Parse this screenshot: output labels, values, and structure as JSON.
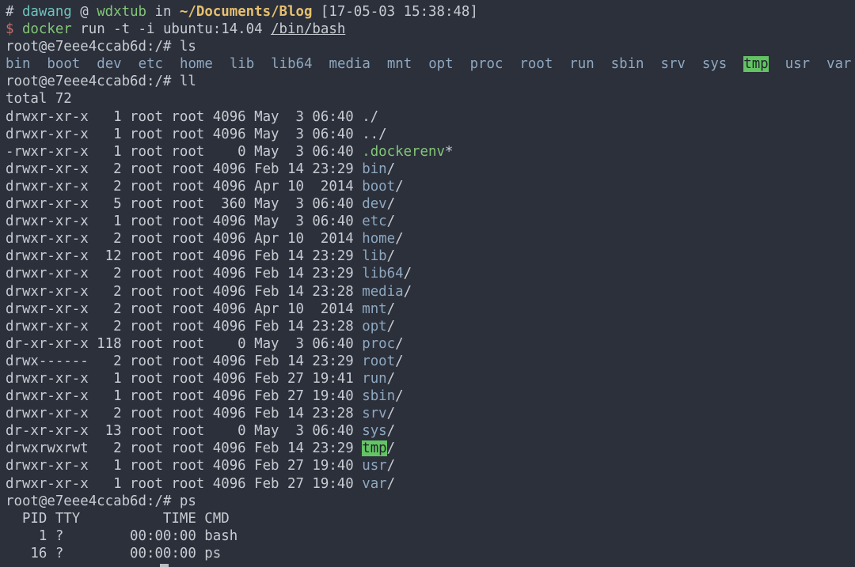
{
  "terminal": {
    "title": "shell session - docker run ubuntu:14.04",
    "colors": {
      "bg": "#2b303b",
      "fg": "#c7ccd2",
      "cyan": "#6ec3bd",
      "green": "#83c577",
      "yellow": "#e6c06e",
      "red": "#c96c68",
      "blue": "#8fa8c0",
      "selGreenBg": "#63c463",
      "selText": "#20242c",
      "cursor": "#b9bec4"
    },
    "lines": [
      {
        "segs": [
          {
            "t": "# ",
            "c": "fg"
          },
          {
            "t": "dawang",
            "c": "cyan"
          },
          {
            "t": " @ ",
            "c": "fg"
          },
          {
            "t": "wdxtub",
            "c": "green"
          },
          {
            "t": " in ",
            "c": "fg"
          },
          {
            "t": "~/Documents/Blog",
            "c": "yellow",
            "b": true
          },
          {
            "t": " [17-05-03 15:38:48]",
            "c": "fg"
          }
        ]
      },
      {
        "segs": [
          {
            "t": "$ ",
            "c": "red"
          },
          {
            "t": "docker",
            "c": "green"
          },
          {
            "t": " run -t -i ubuntu:14.04 ",
            "c": "fg"
          },
          {
            "t": "/bin/bash",
            "c": "fg",
            "u": true
          }
        ]
      },
      {
        "segs": [
          {
            "t": "root@e7eee4ccab6d:/# ls"
          }
        ]
      },
      {
        "segs": [
          {
            "t": "bin",
            "c": "blue"
          },
          {
            "t": "  "
          },
          {
            "t": "boot",
            "c": "blue"
          },
          {
            "t": "  "
          },
          {
            "t": "dev",
            "c": "blue"
          },
          {
            "t": "  "
          },
          {
            "t": "etc",
            "c": "blue"
          },
          {
            "t": "  "
          },
          {
            "t": "home",
            "c": "blue"
          },
          {
            "t": "  "
          },
          {
            "t": "lib",
            "c": "blue"
          },
          {
            "t": "  "
          },
          {
            "t": "lib64",
            "c": "blue"
          },
          {
            "t": "  "
          },
          {
            "t": "media",
            "c": "blue"
          },
          {
            "t": "  "
          },
          {
            "t": "mnt",
            "c": "blue"
          },
          {
            "t": "  "
          },
          {
            "t": "opt",
            "c": "blue"
          },
          {
            "t": "  "
          },
          {
            "t": "proc",
            "c": "blue"
          },
          {
            "t": "  "
          },
          {
            "t": "root",
            "c": "blue"
          },
          {
            "t": "  "
          },
          {
            "t": "run",
            "c": "blue"
          },
          {
            "t": "  "
          },
          {
            "t": "sbin",
            "c": "blue"
          },
          {
            "t": "  "
          },
          {
            "t": "srv",
            "c": "blue"
          },
          {
            "t": "  "
          },
          {
            "t": "sys",
            "c": "blue"
          },
          {
            "t": "  "
          },
          {
            "t": "tmp",
            "c": "selText",
            "bg": "selGreenBg"
          },
          {
            "t": "  "
          },
          {
            "t": "usr",
            "c": "blue"
          },
          {
            "t": "  "
          },
          {
            "t": "var",
            "c": "blue"
          }
        ]
      },
      {
        "segs": [
          {
            "t": "root@e7eee4ccab6d:/# ll"
          }
        ]
      },
      {
        "segs": [
          {
            "t": "total 72"
          }
        ]
      },
      {
        "segs": [
          {
            "t": "drwxr-xr-x   1 root root 4096 May  3 06:40 ./"
          }
        ]
      },
      {
        "segs": [
          {
            "t": "drwxr-xr-x   1 root root 4096 May  3 06:40 ../"
          }
        ]
      },
      {
        "segs": [
          {
            "t": "-rwxr-xr-x   1 root root    0 May  3 06:40 "
          },
          {
            "t": ".dockerenv",
            "c": "green"
          },
          {
            "t": "*"
          }
        ]
      },
      {
        "segs": [
          {
            "t": "drwxr-xr-x   2 root root 4096 Feb 14 23:29 "
          },
          {
            "t": "bin",
            "c": "blue"
          },
          {
            "t": "/"
          }
        ]
      },
      {
        "segs": [
          {
            "t": "drwxr-xr-x   2 root root 4096 Apr 10  2014 "
          },
          {
            "t": "boot",
            "c": "blue"
          },
          {
            "t": "/"
          }
        ]
      },
      {
        "segs": [
          {
            "t": "drwxr-xr-x   5 root root  360 May  3 06:40 "
          },
          {
            "t": "dev",
            "c": "blue"
          },
          {
            "t": "/"
          }
        ]
      },
      {
        "segs": [
          {
            "t": "drwxr-xr-x   1 root root 4096 May  3 06:40 "
          },
          {
            "t": "etc",
            "c": "blue"
          },
          {
            "t": "/"
          }
        ]
      },
      {
        "segs": [
          {
            "t": "drwxr-xr-x   2 root root 4096 Apr 10  2014 "
          },
          {
            "t": "home",
            "c": "blue"
          },
          {
            "t": "/"
          }
        ]
      },
      {
        "segs": [
          {
            "t": "drwxr-xr-x  12 root root 4096 Feb 14 23:29 "
          },
          {
            "t": "lib",
            "c": "blue"
          },
          {
            "t": "/"
          }
        ]
      },
      {
        "segs": [
          {
            "t": "drwxr-xr-x   2 root root 4096 Feb 14 23:29 "
          },
          {
            "t": "lib64",
            "c": "blue"
          },
          {
            "t": "/"
          }
        ]
      },
      {
        "segs": [
          {
            "t": "drwxr-xr-x   2 root root 4096 Feb 14 23:28 "
          },
          {
            "t": "media",
            "c": "blue"
          },
          {
            "t": "/"
          }
        ]
      },
      {
        "segs": [
          {
            "t": "drwxr-xr-x   2 root root 4096 Apr 10  2014 "
          },
          {
            "t": "mnt",
            "c": "blue"
          },
          {
            "t": "/"
          }
        ]
      },
      {
        "segs": [
          {
            "t": "drwxr-xr-x   2 root root 4096 Feb 14 23:28 "
          },
          {
            "t": "opt",
            "c": "blue"
          },
          {
            "t": "/"
          }
        ]
      },
      {
        "segs": [
          {
            "t": "dr-xr-xr-x 118 root root    0 May  3 06:40 "
          },
          {
            "t": "proc",
            "c": "blue"
          },
          {
            "t": "/"
          }
        ]
      },
      {
        "segs": [
          {
            "t": "drwx------   2 root root 4096 Feb 14 23:29 "
          },
          {
            "t": "root",
            "c": "blue"
          },
          {
            "t": "/"
          }
        ]
      },
      {
        "segs": [
          {
            "t": "drwxr-xr-x   1 root root 4096 Feb 27 19:41 "
          },
          {
            "t": "run",
            "c": "blue"
          },
          {
            "t": "/"
          }
        ]
      },
      {
        "segs": [
          {
            "t": "drwxr-xr-x   1 root root 4096 Feb 27 19:40 "
          },
          {
            "t": "sbin",
            "c": "blue"
          },
          {
            "t": "/"
          }
        ]
      },
      {
        "segs": [
          {
            "t": "drwxr-xr-x   2 root root 4096 Feb 14 23:28 "
          },
          {
            "t": "srv",
            "c": "blue"
          },
          {
            "t": "/"
          }
        ]
      },
      {
        "segs": [
          {
            "t": "dr-xr-xr-x  13 root root    0 May  3 06:40 "
          },
          {
            "t": "sys",
            "c": "blue"
          },
          {
            "t": "/"
          }
        ]
      },
      {
        "segs": [
          {
            "t": "drwxrwxrwt   2 root root 4096 Feb 14 23:29 "
          },
          {
            "t": "tmp",
            "c": "selText",
            "bg": "selGreenBg"
          },
          {
            "t": "/"
          }
        ]
      },
      {
        "segs": [
          {
            "t": "drwxr-xr-x   1 root root 4096 Feb 27 19:40 "
          },
          {
            "t": "usr",
            "c": "blue"
          },
          {
            "t": "/"
          }
        ]
      },
      {
        "segs": [
          {
            "t": "drwxr-xr-x   1 root root 4096 Feb 27 19:40 "
          },
          {
            "t": "var",
            "c": "blue"
          },
          {
            "t": "/"
          }
        ]
      },
      {
        "segs": [
          {
            "t": "root@e7eee4ccab6d:/# ps"
          }
        ]
      },
      {
        "segs": [
          {
            "t": "  PID TTY          TIME CMD"
          }
        ]
      },
      {
        "segs": [
          {
            "t": "    1 ?        00:00:00 bash"
          }
        ]
      },
      {
        "segs": [
          {
            "t": "   16 ?        00:00:00 ps"
          }
        ]
      }
    ]
  }
}
